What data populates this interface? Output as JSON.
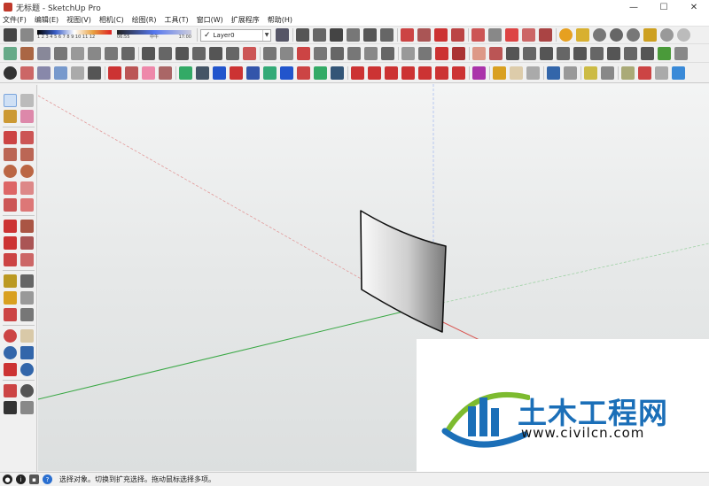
{
  "window": {
    "title": "无标题 - SketchUp Pro",
    "minimize": "—",
    "maximize": "☐",
    "close": "✕"
  },
  "menu": [
    "文件(F)",
    "编辑(E)",
    "视图(V)",
    "相机(C)",
    "绘图(R)",
    "工具(T)",
    "窗口(W)",
    "扩展程序",
    "帮助(H)"
  ],
  "shadow_settings": {
    "months": "1 2 3 4 5 6 7 8 9 10 11 12",
    "time_start": "06:55",
    "time_mid": "中午",
    "time_end": "17:00"
  },
  "layer": {
    "check": "✓",
    "name": "Layer0"
  },
  "status": {
    "message": "选择对象。切换到扩充选择。拖动鼠标选择多项。"
  },
  "watermark": {
    "title": "土木工程网",
    "url": "www.civilcn.com"
  },
  "colors": {
    "red_axis": "#d9534f",
    "green_axis": "#3aa845",
    "blue_axis": "#5b7fe0",
    "brand_blue": "#1b6fb8",
    "brand_green": "#7dbb2f"
  }
}
